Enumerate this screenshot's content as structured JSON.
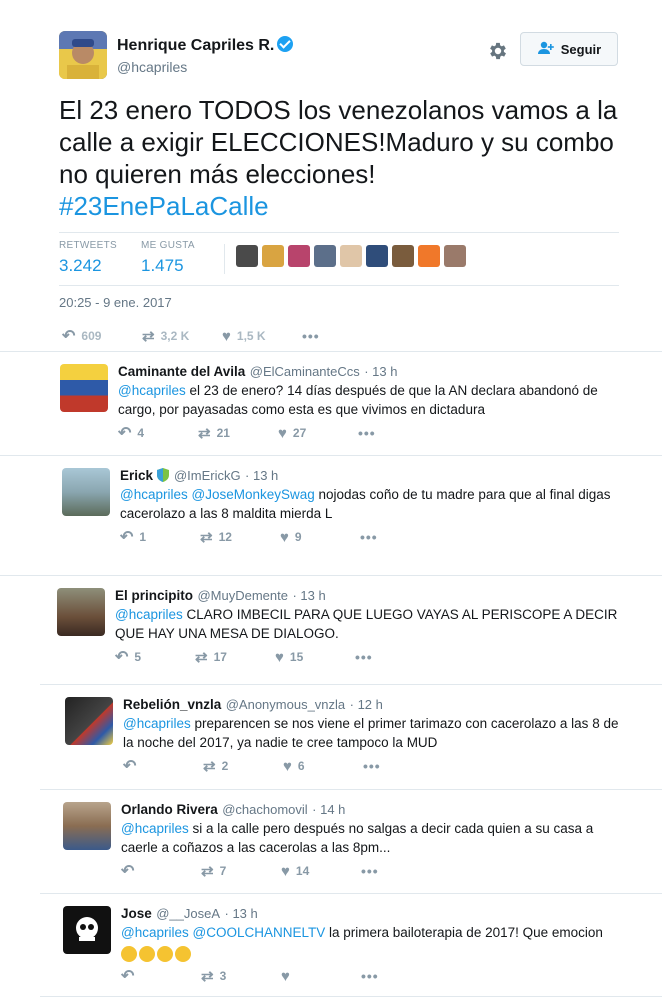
{
  "tweet": {
    "name": "Henrique Capriles R.",
    "handle": "@hcapriles",
    "follow_label": "Seguir",
    "text": "El 23 enero TODOS los venezolanos vamos a la calle a exigir ELECCIONES!Maduro y su combo no quieren más elecciones!",
    "hashtag": "#23EnePaLaCalle",
    "retweets_label": "RETWEETS",
    "retweets_value": "3.242",
    "likes_label": "ME GUSTA",
    "likes_value": "1.475",
    "timestamp": "20:25 - 9 ene. 2017",
    "actions": {
      "replies": "609",
      "retweets": "3,2 K",
      "likes": "1,5 K"
    }
  },
  "liker_faces_colors": [
    "#4a4a4a",
    "#d9a441",
    "#b8446c",
    "#5c6f8a",
    "#e0c6a8",
    "#2f4d7a",
    "#7a5c3d",
    "#f0782a",
    "#9a7a6a"
  ],
  "replies": [
    {
      "name": "Caminante del Avila",
      "handle": "@ElCaminanteCcs",
      "time": "13 h",
      "mention": "@hcapriles",
      "text": " el 23 de enero? 14 días después de que la AN declara abandonó de cargo, por payasadas como esta es que vivimos en dictadura",
      "reply_count": "4",
      "rt_count": "21",
      "like_count": "27"
    },
    {
      "name": "Erick",
      "handle": "@ImErickG",
      "time": "13 h",
      "mention": "@hcapriles",
      "mention2": "@JoseMonkeySwag",
      "text": " nojodas coño de tu madre para que al final digas cacerolazo a las 8 maldita mierda L",
      "reply_count": "1",
      "rt_count": "12",
      "like_count": "9"
    },
    {
      "name": "El principito",
      "handle": "@MuyDemente",
      "time": "13 h",
      "mention": "@hcapriles",
      "text": " CLARO IMBECIL PARA QUE LUEGO VAYAS AL PERISCOPE A DECIR QUE HAY UNA MESA DE DIALOGO.",
      "reply_count": "5",
      "rt_count": "17",
      "like_count": "15"
    },
    {
      "name": "Rebelión_vnzla",
      "handle": "@Anonymous_vnzla",
      "time": "12 h",
      "mention": "@hcapriles",
      "text": " preparencen se nos viene el primer  tarimazo con cacerolazo a las 8 de la noche del 2017, ya nadie te cree tampoco la MUD",
      "reply_count": "",
      "rt_count": "2",
      "like_count": "6"
    },
    {
      "name": "Orlando Rivera",
      "handle": "@chachomovil",
      "time": "14 h",
      "mention": "@hcapriles",
      "text": " si a la calle pero después no salgas a decir cada quien a su casa a caerle a coñazos a las cacerolas a las 8pm...",
      "reply_count": "",
      "rt_count": "7",
      "like_count": "14"
    },
    {
      "name": "Jose",
      "handle": "@__JoseA",
      "time": "13 h",
      "mention": "@hcapriles",
      "mention2": "@COOLCHANNELTV",
      "text": " la primera bailoterapia de 2017! Que emocion",
      "reply_count": "",
      "rt_count": "3",
      "like_count": ""
    }
  ],
  "icons": {
    "reply": "reply-arrow-icon",
    "retweet": "retweet-icon",
    "like": "heart-icon",
    "more": "more-dots-icon",
    "gear": "gear-icon",
    "follow": "add-user-icon"
  },
  "colors": {
    "link": "#1b95e0",
    "verified": "#1da1f2"
  }
}
